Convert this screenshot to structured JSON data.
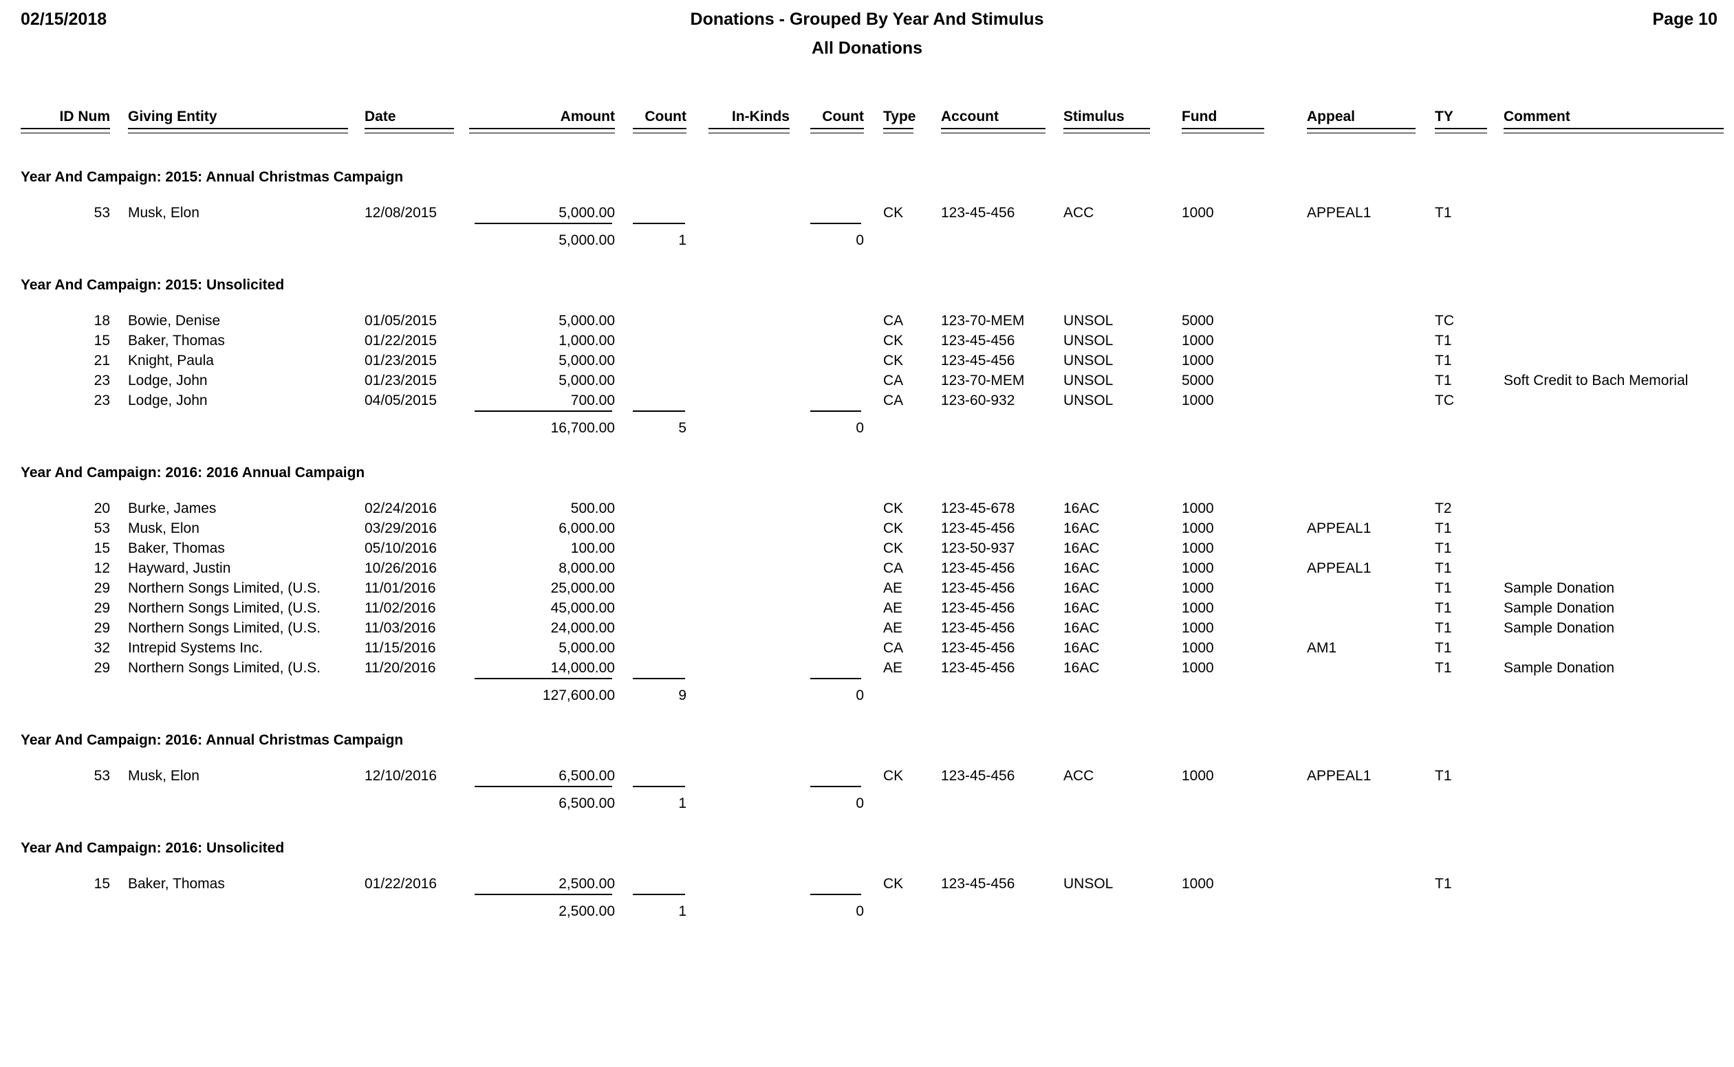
{
  "header": {
    "date": "02/15/2018",
    "title": "Donations - Grouped By Year And Stimulus",
    "subtitle": "All Donations",
    "page_label": "Page 10"
  },
  "columns": [
    {
      "key": "id_num",
      "label": "ID Num"
    },
    {
      "key": "entity",
      "label": "Giving Entity"
    },
    {
      "key": "date",
      "label": "Date"
    },
    {
      "key": "amount",
      "label": "Amount"
    },
    {
      "key": "count",
      "label": "Count"
    },
    {
      "key": "inkinds",
      "label": "In-Kinds"
    },
    {
      "key": "count2",
      "label": "Count"
    },
    {
      "key": "type",
      "label": "Type"
    },
    {
      "key": "account",
      "label": "Account"
    },
    {
      "key": "stimulus",
      "label": "Stimulus"
    },
    {
      "key": "fund",
      "label": "Fund"
    },
    {
      "key": "appeal",
      "label": "Appeal"
    },
    {
      "key": "ty",
      "label": "TY"
    },
    {
      "key": "comment",
      "label": "Comment"
    }
  ],
  "group_label_prefix": "Year And Campaign:",
  "groups": [
    {
      "title": "Year And Campaign: 2015: Annual Christmas Campaign",
      "rows": [
        {
          "id_num": "53",
          "entity": "Musk, Elon",
          "date": "12/08/2015",
          "amount": "5,000.00",
          "count": "",
          "inkinds": "",
          "count2": "",
          "type": "CK",
          "account": "123-45-456",
          "stimulus": "ACC",
          "fund": "1000",
          "appeal": "APPEAL1",
          "ty": "T1",
          "comment": ""
        }
      ],
      "subtotal": {
        "amount": "5,000.00",
        "count": "1",
        "inkinds": "",
        "count2": "0"
      }
    },
    {
      "title": "Year And Campaign: 2015: Unsolicited",
      "rows": [
        {
          "id_num": "18",
          "entity": "Bowie, Denise",
          "date": "01/05/2015",
          "amount": "5,000.00",
          "count": "",
          "inkinds": "",
          "count2": "",
          "type": "CA",
          "account": "123-70-MEM",
          "stimulus": "UNSOL",
          "fund": "5000",
          "appeal": "",
          "ty": "TC",
          "comment": ""
        },
        {
          "id_num": "15",
          "entity": "Baker, Thomas",
          "date": "01/22/2015",
          "amount": "1,000.00",
          "count": "",
          "inkinds": "",
          "count2": "",
          "type": "CK",
          "account": "123-45-456",
          "stimulus": "UNSOL",
          "fund": "1000",
          "appeal": "",
          "ty": "T1",
          "comment": ""
        },
        {
          "id_num": "21",
          "entity": "Knight, Paula",
          "date": "01/23/2015",
          "amount": "5,000.00",
          "count": "",
          "inkinds": "",
          "count2": "",
          "type": "CK",
          "account": "123-45-456",
          "stimulus": "UNSOL",
          "fund": "1000",
          "appeal": "",
          "ty": "T1",
          "comment": ""
        },
        {
          "id_num": "23",
          "entity": "Lodge, John",
          "date": "01/23/2015",
          "amount": "5,000.00",
          "count": "",
          "inkinds": "",
          "count2": "",
          "type": "CA",
          "account": "123-70-MEM",
          "stimulus": "UNSOL",
          "fund": "5000",
          "appeal": "",
          "ty": "T1",
          "comment": "Soft Credit to Bach Memorial"
        },
        {
          "id_num": "23",
          "entity": "Lodge, John",
          "date": "04/05/2015",
          "amount": "700.00",
          "count": "",
          "inkinds": "",
          "count2": "",
          "type": "CA",
          "account": "123-60-932",
          "stimulus": "UNSOL",
          "fund": "1000",
          "appeal": "",
          "ty": "TC",
          "comment": ""
        }
      ],
      "subtotal": {
        "amount": "16,700.00",
        "count": "5",
        "inkinds": "",
        "count2": "0"
      }
    },
    {
      "title": "Year And Campaign: 2016: 2016 Annual Campaign",
      "rows": [
        {
          "id_num": "20",
          "entity": "Burke, James",
          "date": "02/24/2016",
          "amount": "500.00",
          "count": "",
          "inkinds": "",
          "count2": "",
          "type": "CK",
          "account": "123-45-678",
          "stimulus": "16AC",
          "fund": "1000",
          "appeal": "",
          "ty": "T2",
          "comment": ""
        },
        {
          "id_num": "53",
          "entity": "Musk, Elon",
          "date": "03/29/2016",
          "amount": "6,000.00",
          "count": "",
          "inkinds": "",
          "count2": "",
          "type": "CK",
          "account": "123-45-456",
          "stimulus": "16AC",
          "fund": "1000",
          "appeal": "APPEAL1",
          "ty": "T1",
          "comment": ""
        },
        {
          "id_num": "15",
          "entity": "Baker, Thomas",
          "date": "05/10/2016",
          "amount": "100.00",
          "count": "",
          "inkinds": "",
          "count2": "",
          "type": "CK",
          "account": "123-50-937",
          "stimulus": "16AC",
          "fund": "1000",
          "appeal": "",
          "ty": "T1",
          "comment": ""
        },
        {
          "id_num": "12",
          "entity": "Hayward, Justin",
          "date": "10/26/2016",
          "amount": "8,000.00",
          "count": "",
          "inkinds": "",
          "count2": "",
          "type": "CA",
          "account": "123-45-456",
          "stimulus": "16AC",
          "fund": "1000",
          "appeal": "APPEAL1",
          "ty": "T1",
          "comment": ""
        },
        {
          "id_num": "29",
          "entity": "Northern Songs Limited, (U.S.",
          "date": "11/01/2016",
          "amount": "25,000.00",
          "count": "",
          "inkinds": "",
          "count2": "",
          "type": "AE",
          "account": "123-45-456",
          "stimulus": "16AC",
          "fund": "1000",
          "appeal": "",
          "ty": "T1",
          "comment": "Sample Donation"
        },
        {
          "id_num": "29",
          "entity": "Northern Songs Limited, (U.S.",
          "date": "11/02/2016",
          "amount": "45,000.00",
          "count": "",
          "inkinds": "",
          "count2": "",
          "type": "AE",
          "account": "123-45-456",
          "stimulus": "16AC",
          "fund": "1000",
          "appeal": "",
          "ty": "T1",
          "comment": "Sample Donation"
        },
        {
          "id_num": "29",
          "entity": "Northern Songs Limited, (U.S.",
          "date": "11/03/2016",
          "amount": "24,000.00",
          "count": "",
          "inkinds": "",
          "count2": "",
          "type": "AE",
          "account": "123-45-456",
          "stimulus": "16AC",
          "fund": "1000",
          "appeal": "",
          "ty": "T1",
          "comment": "Sample Donation"
        },
        {
          "id_num": "32",
          "entity": "Intrepid Systems Inc.",
          "date": "11/15/2016",
          "amount": "5,000.00",
          "count": "",
          "inkinds": "",
          "count2": "",
          "type": "CA",
          "account": "123-45-456",
          "stimulus": "16AC",
          "fund": "1000",
          "appeal": "AM1",
          "ty": "T1",
          "comment": ""
        },
        {
          "id_num": "29",
          "entity": "Northern Songs Limited, (U.S.",
          "date": "11/20/2016",
          "amount": "14,000.00",
          "count": "",
          "inkinds": "",
          "count2": "",
          "type": "AE",
          "account": "123-45-456",
          "stimulus": "16AC",
          "fund": "1000",
          "appeal": "",
          "ty": "T1",
          "comment": "Sample Donation"
        }
      ],
      "subtotal": {
        "amount": "127,600.00",
        "count": "9",
        "inkinds": "",
        "count2": "0"
      }
    },
    {
      "title": "Year And Campaign: 2016: Annual Christmas Campaign",
      "rows": [
        {
          "id_num": "53",
          "entity": "Musk, Elon",
          "date": "12/10/2016",
          "amount": "6,500.00",
          "count": "",
          "inkinds": "",
          "count2": "",
          "type": "CK",
          "account": "123-45-456",
          "stimulus": "ACC",
          "fund": "1000",
          "appeal": "APPEAL1",
          "ty": "T1",
          "comment": ""
        }
      ],
      "subtotal": {
        "amount": "6,500.00",
        "count": "1",
        "inkinds": "",
        "count2": "0"
      }
    },
    {
      "title": "Year And Campaign: 2016: Unsolicited",
      "rows": [
        {
          "id_num": "15",
          "entity": "Baker, Thomas",
          "date": "01/22/2016",
          "amount": "2,500.00",
          "count": "",
          "inkinds": "",
          "count2": "",
          "type": "CK",
          "account": "123-45-456",
          "stimulus": "UNSOL",
          "fund": "1000",
          "appeal": "",
          "ty": "T1",
          "comment": ""
        }
      ],
      "subtotal": {
        "amount": "2,500.00",
        "count": "1",
        "inkinds": "",
        "count2": "0"
      }
    }
  ],
  "colors": {
    "text": "#000000",
    "background": "#ffffff",
    "rule": "#000000"
  }
}
